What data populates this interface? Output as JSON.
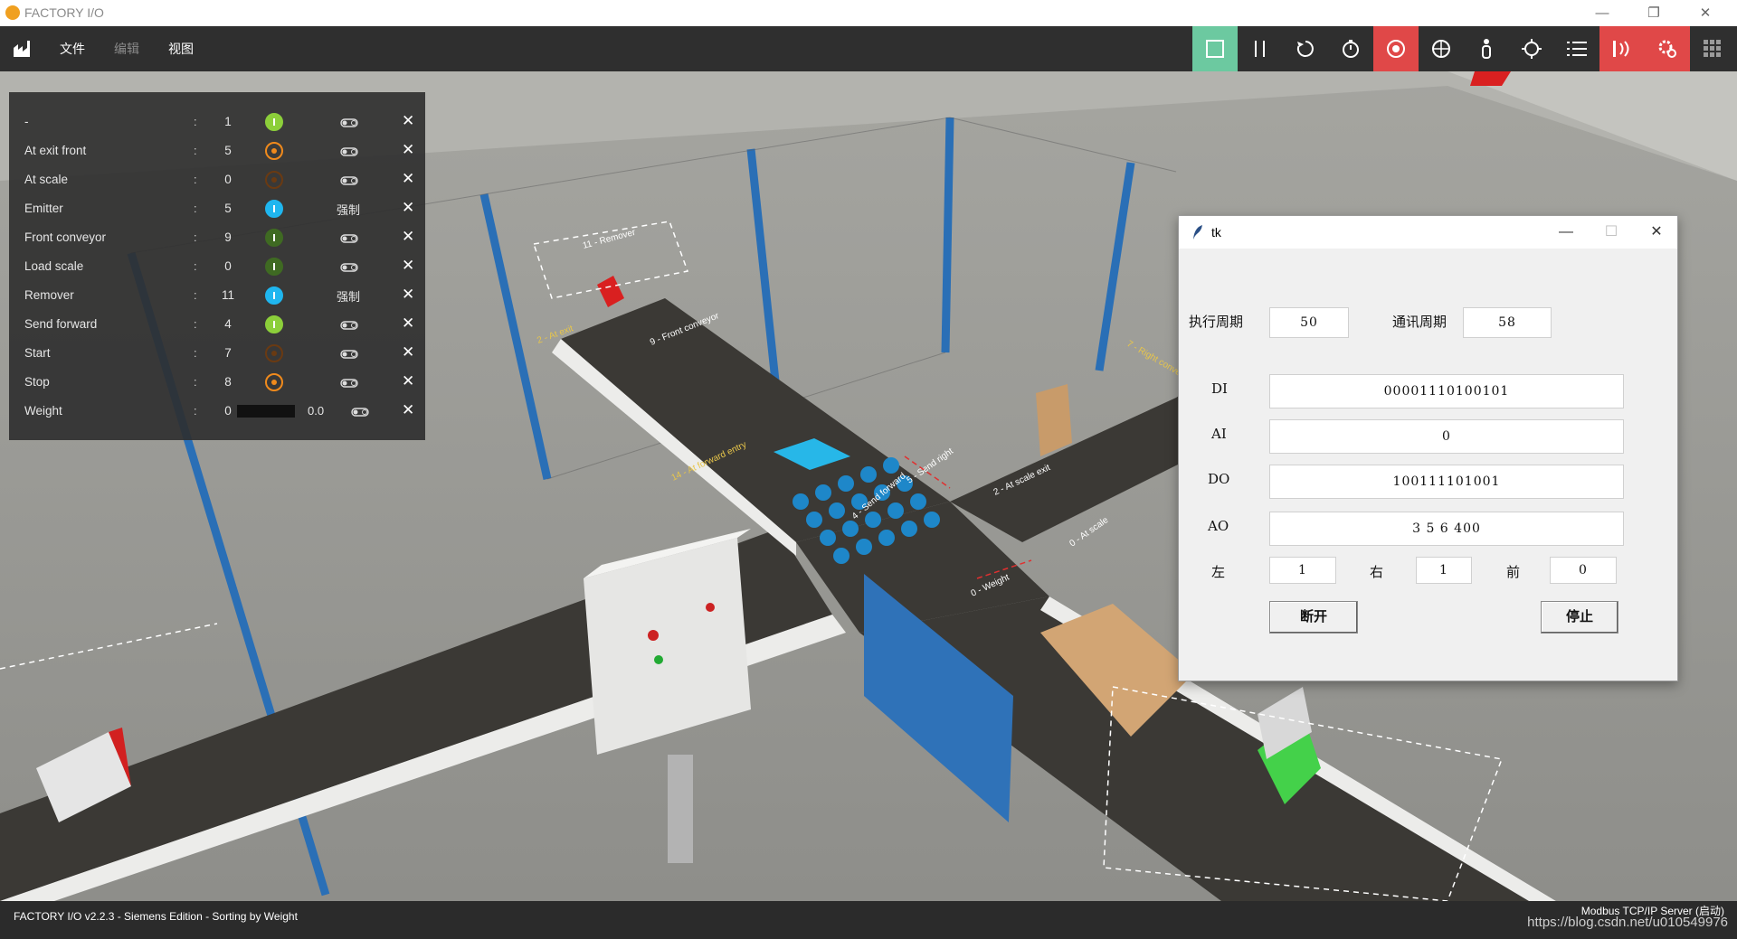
{
  "titlebar": {
    "app_title": "FACTORY I/O",
    "minimize": "—",
    "restore": "❐",
    "close": "✕"
  },
  "menubar": {
    "file": "文件",
    "edit": "编辑",
    "view": "视图",
    "tools": [
      "stop-icon",
      "pause-icon",
      "reset-icon",
      "timer-icon",
      "camera-orbit-icon",
      "camera-fly-icon",
      "camera-first-person-icon",
      "target-icon",
      "list-icon",
      "sensors-icon",
      "drivers-icon",
      "grid-icon"
    ]
  },
  "tags": [
    {
      "name": "-",
      "value": "1",
      "indicator": "green",
      "force": "",
      "indicator_icon": "on"
    },
    {
      "name": "At exit front",
      "value": "5",
      "indicator": "orange-ring",
      "force": ""
    },
    {
      "name": "At scale",
      "value": "0",
      "indicator": "dark-orange-ring",
      "force": ""
    },
    {
      "name": "Emitter",
      "value": "5",
      "indicator": "blue",
      "force": "强制"
    },
    {
      "name": "Front conveyor",
      "value": "9",
      "indicator": "dark-green",
      "force": ""
    },
    {
      "name": "Load scale",
      "value": "0",
      "indicator": "dark-green",
      "force": ""
    },
    {
      "name": "Remover",
      "value": "11",
      "indicator": "blue",
      "force": "强制"
    },
    {
      "name": "Send forward",
      "value": "4",
      "indicator": "green",
      "force": ""
    },
    {
      "name": "Start",
      "value": "7",
      "indicator": "dark-orange-ring",
      "force": ""
    },
    {
      "name": "Stop",
      "value": "8",
      "indicator": "orange-ring",
      "force": ""
    },
    {
      "name": "Weight",
      "value": "0",
      "indicator": "",
      "force": "",
      "readout": "0.0",
      "weight_fraction": 0
    }
  ],
  "tag_colon": ":",
  "tag_close": "✕",
  "tk_window": {
    "title": "tk",
    "exec_period_label": "执行周期",
    "exec_period_value": "50",
    "comm_period_label": "通讯周期",
    "comm_period_value": "58",
    "di_label": "DI",
    "di_value": "00001110100101",
    "ai_label": "AI",
    "ai_value": "0",
    "do_label": "DO",
    "do_value": "100111101001",
    "ao_label": "AO",
    "ao_value": "3 5 6 400",
    "left_label": "左",
    "left_value": "1",
    "right_label": "右",
    "right_value": "1",
    "front_label": "前",
    "front_value": "0",
    "disconnect_button": "断开",
    "stop_button": "停止",
    "minimize": "—",
    "maximize": "☐",
    "close": "✕"
  },
  "scene_labels": {
    "remover": "11 - Remover",
    "front_conveyor": "9 - Front conveyor",
    "at_forward_entry": "14 - At forward entry",
    "at_scale_exit": "2 - At scale exit",
    "at_scale": "0 - At scale",
    "weight": "0 - Weight",
    "send_right": "5 - Send right",
    "send_forward": "4 - Send forward",
    "at_exit": "2 - At exit",
    "right_conveyor": "7 - Right conveyor"
  },
  "statusbar": {
    "app_info": "FACTORY I/O v2.2.3 - Siemens Edition - Sorting by Weight",
    "driver_status": "Modbus TCP/IP Server (启动)",
    "watermark": "https://blog.csdn.net/u010549976"
  }
}
